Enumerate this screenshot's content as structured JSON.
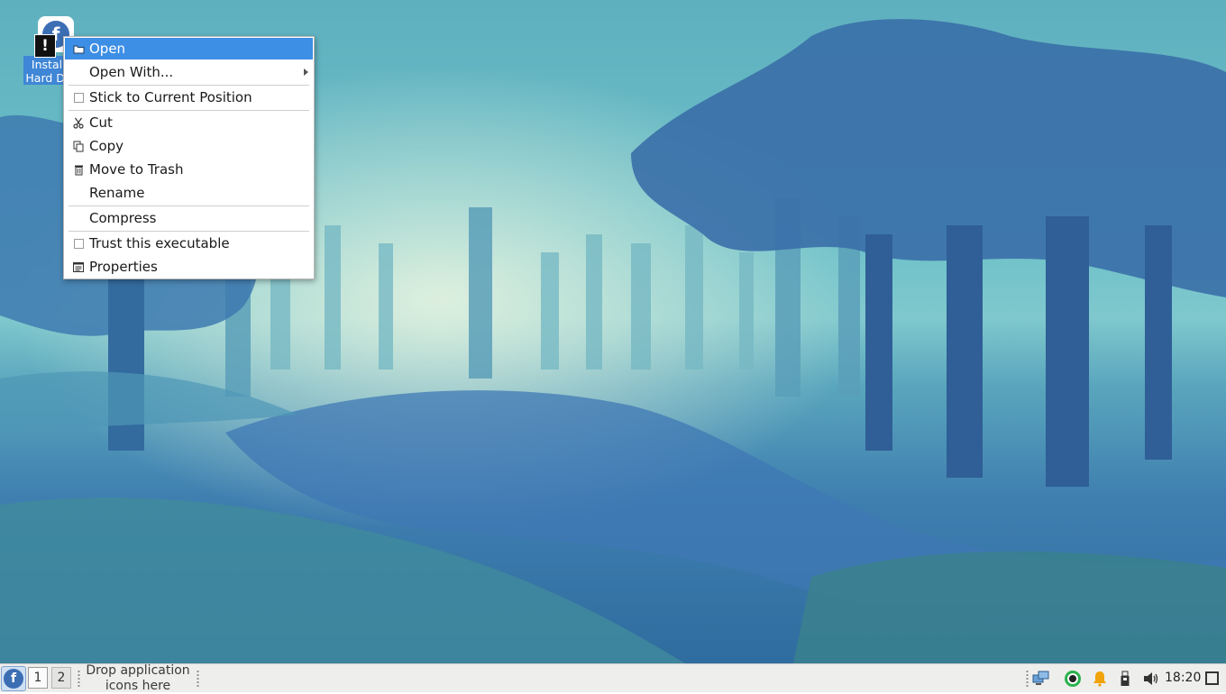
{
  "desktop": {
    "icon": {
      "label_line1": "Install to",
      "label_line2": "Hard Drive",
      "icon": "fedora-logo-icon",
      "badge_icon": "warning-icon"
    }
  },
  "context_menu": {
    "items": [
      {
        "label": "Open",
        "icon": "folder-open-icon",
        "active": true
      },
      {
        "label": "Open With...",
        "submenu": true
      },
      {
        "label": "Stick to Current Position",
        "checkbox": true,
        "checked": false
      },
      {
        "label": "Cut",
        "icon": "scissors-icon"
      },
      {
        "label": "Copy",
        "icon": "copy-icon"
      },
      {
        "label": "Move to Trash",
        "icon": "trash-icon"
      },
      {
        "label": "Rename"
      },
      {
        "label": "Compress"
      },
      {
        "label": "Trust this executable",
        "checkbox": true,
        "checked": false
      },
      {
        "label": "Properties",
        "icon": "properties-icon"
      }
    ]
  },
  "panel": {
    "menu_icon": "fedora-logo-icon",
    "workspaces": [
      "1",
      "2"
    ],
    "launcher_text_line1": "Drop application",
    "launcher_text_line2": "icons here",
    "tray": [
      "network-icon",
      "record-icon",
      "notification-bell-icon",
      "usb-icon",
      "volume-icon"
    ],
    "clock": "18:20",
    "show_desktop_icon": "show-desktop-icon"
  },
  "colors": {
    "menu_highlight": "#3d8ee5",
    "panel_bg": "#eeeeec",
    "bell": "#f0a30a",
    "record": "#2bb24c"
  }
}
